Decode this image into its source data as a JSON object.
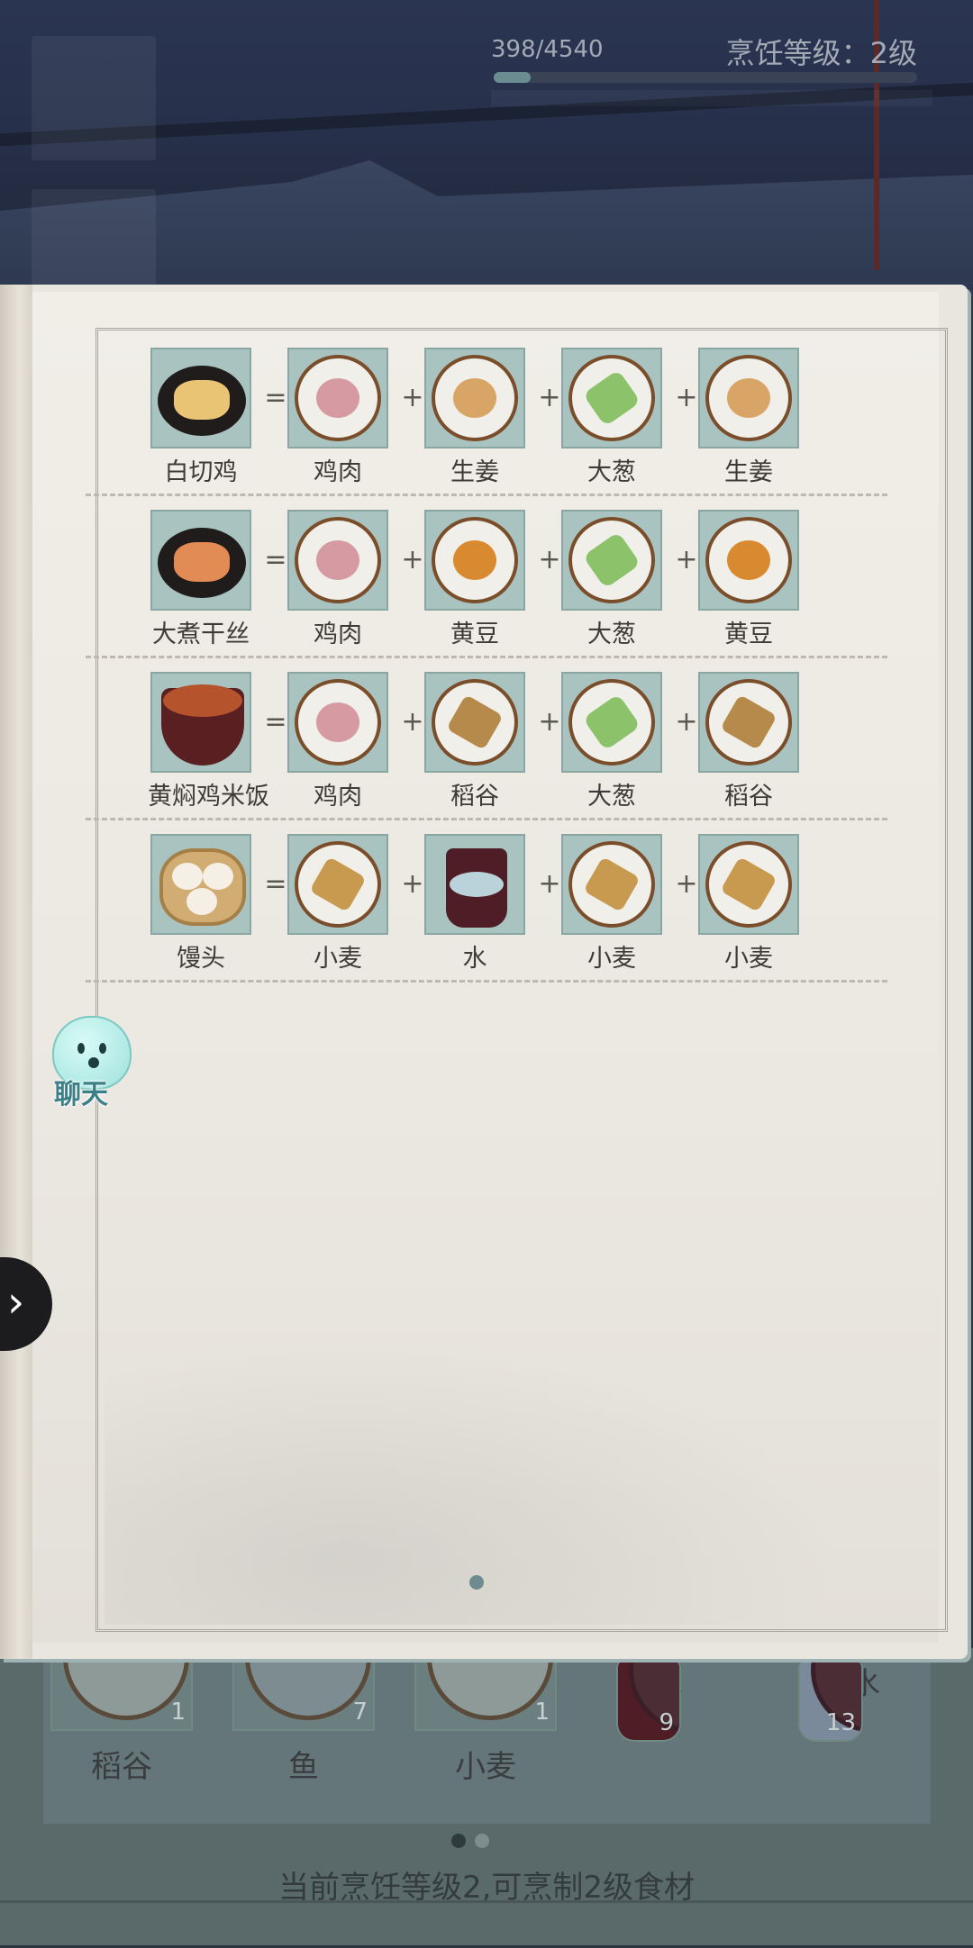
{
  "header": {
    "progress_text": "398/4540",
    "progress_fraction": 0.088,
    "level_text": "烹饪等级：2级"
  },
  "recipes": [
    {
      "dish": "白切鸡",
      "dish_icon": "poached-chicken-icon",
      "ingredients": [
        {
          "name": "鸡肉",
          "icon": "chicken-meat-icon"
        },
        {
          "name": "生姜",
          "icon": "ginger-icon"
        },
        {
          "name": "大葱",
          "icon": "scallion-icon"
        },
        {
          "name": "生姜",
          "icon": "ginger-icon"
        }
      ]
    },
    {
      "dish": "大煮干丝",
      "dish_icon": "shredded-tofu-dish-icon",
      "ingredients": [
        {
          "name": "鸡肉",
          "icon": "chicken-meat-icon"
        },
        {
          "name": "黄豆",
          "icon": "soybean-icon"
        },
        {
          "name": "大葱",
          "icon": "scallion-icon"
        },
        {
          "name": "黄豆",
          "icon": "soybean-icon"
        }
      ]
    },
    {
      "dish": "黄焖鸡米饭",
      "dish_icon": "braised-chicken-rice-icon",
      "ingredients": [
        {
          "name": "鸡肉",
          "icon": "chicken-meat-icon"
        },
        {
          "name": "稻谷",
          "icon": "rice-grain-icon"
        },
        {
          "name": "大葱",
          "icon": "scallion-icon"
        },
        {
          "name": "稻谷",
          "icon": "rice-grain-icon"
        }
      ]
    },
    {
      "dish": "馒头",
      "dish_icon": "steamed-bun-icon",
      "ingredients": [
        {
          "name": "小麦",
          "icon": "wheat-icon"
        },
        {
          "name": "水",
          "icon": "water-bucket-icon"
        },
        {
          "name": "小麦",
          "icon": "wheat-icon"
        },
        {
          "name": "小麦",
          "icon": "wheat-icon"
        }
      ]
    }
  ],
  "operators": {
    "equals": "=",
    "plus": "+"
  },
  "chat": {
    "label": "聊天"
  },
  "side_toggle": {
    "glyph": "›"
  },
  "inventory": [
    {
      "name": "稻谷",
      "count": "1"
    },
    {
      "name": "鱼",
      "count": "7"
    },
    {
      "name": "小麦",
      "count": "1"
    },
    {
      "name": "水",
      "count": "9"
    },
    {
      "name": "雪水",
      "count": "13"
    }
  ],
  "bottom_status": "当前烹饪等级2,可烹制2级食材",
  "colors": {
    "tile": "#a9c3c1",
    "page": "#ebe8e1",
    "accent": "#6e8c8f"
  }
}
